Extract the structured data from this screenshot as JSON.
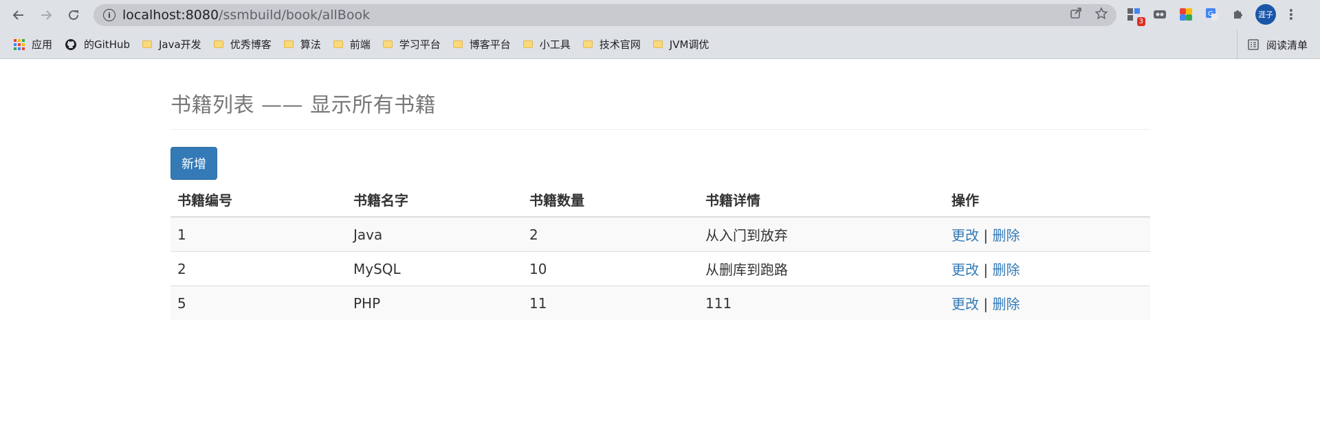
{
  "browser": {
    "url_host": "localhost:8080",
    "url_path": "/ssmbuild/book/allBook",
    "ext_badge": "3",
    "avatar_text": "涯子"
  },
  "bookmarks": [
    {
      "label": "应用",
      "icon": "apps-grid-icon"
    },
    {
      "label": "的GitHub",
      "icon": "github-icon"
    },
    {
      "label": "Java开发",
      "icon": "folder-icon"
    },
    {
      "label": "优秀博客",
      "icon": "folder-icon"
    },
    {
      "label": "算法",
      "icon": "folder-icon"
    },
    {
      "label": "前端",
      "icon": "folder-icon"
    },
    {
      "label": "学习平台",
      "icon": "folder-icon"
    },
    {
      "label": "博客平台",
      "icon": "folder-icon"
    },
    {
      "label": "小工具",
      "icon": "folder-icon"
    },
    {
      "label": "技术官网",
      "icon": "folder-icon"
    },
    {
      "label": "JVM调优",
      "icon": "folder-icon"
    }
  ],
  "reading_list": "阅读清单",
  "page": {
    "title": "书籍列表 —— 显示所有书籍",
    "add_button": "新增"
  },
  "table": {
    "headers": [
      "书籍编号",
      "书籍名字",
      "书籍数量",
      "书籍详情",
      "操作"
    ],
    "rows": [
      {
        "id": "1",
        "name": "Java",
        "count": "2",
        "detail": "从入门到放弃"
      },
      {
        "id": "2",
        "name": "MySQL",
        "count": "10",
        "detail": "从删库到跑路"
      },
      {
        "id": "5",
        "name": "PHP",
        "count": "11",
        "detail": "111"
      }
    ],
    "edit_label": "更改",
    "sep": "|",
    "delete_label": "删除"
  },
  "colors": {
    "primary": "#337ab7",
    "header_text": "#777777"
  }
}
